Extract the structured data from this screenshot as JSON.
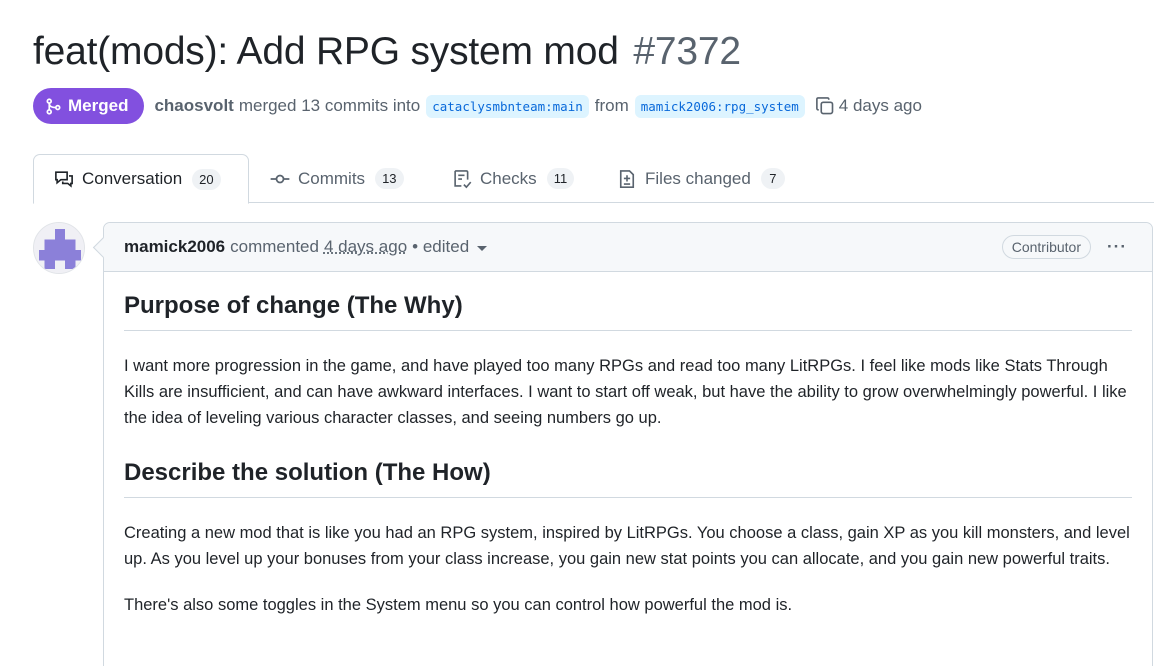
{
  "pr": {
    "title": "feat(mods): Add RPG system mod",
    "number": "#7372",
    "state_label": "Merged",
    "merger": "chaosvolt",
    "merged_text": "merged 13 commits into",
    "base_branch": "cataclysmbnteam:main",
    "from_text": "from",
    "head_branch": "mamick2006:rpg_system",
    "time_ago": "4 days ago"
  },
  "tabs": [
    {
      "label": "Conversation",
      "count": "20",
      "icon": "comment-discussion-icon"
    },
    {
      "label": "Commits",
      "count": "13",
      "icon": "git-commit-icon"
    },
    {
      "label": "Checks",
      "count": "11",
      "icon": "checklist-icon"
    },
    {
      "label": "Files changed",
      "count": "7",
      "icon": "file-diff-icon"
    }
  ],
  "comment": {
    "author": "mamick2006",
    "action": "commented",
    "time": "4 days ago",
    "edited": "• edited",
    "role_badge": "Contributor",
    "menu": "···",
    "heading1": "Purpose of change (The Why)",
    "para1": "I want more progression in the game, and have played too many RPGs and read too many LitRPGs. I feel like mods like Stats Through Kills are insufficient, and can have awkward interfaces. I want to start off weak, but have the ability to grow overwhelmingly powerful. I like the idea of leveling various character classes, and seeing numbers go up.",
    "heading2": "Describe the solution (The How)",
    "para2": "Creating a new mod that is like you had an RPG system, inspired by LitRPGs. You choose a class, gain XP as you kill monsters, and level up. As you level up your bonuses from your class increase, you gain new stat points you can allocate, and you gain new powerful traits.",
    "para3": "There's also some toggles in the System menu so you can control how powerful the mod is."
  },
  "colors": {
    "merged_purple": "#8250df",
    "branch_bg": "#ddf4ff",
    "branch_fg": "#0969da",
    "border": "#d1d9e0"
  }
}
